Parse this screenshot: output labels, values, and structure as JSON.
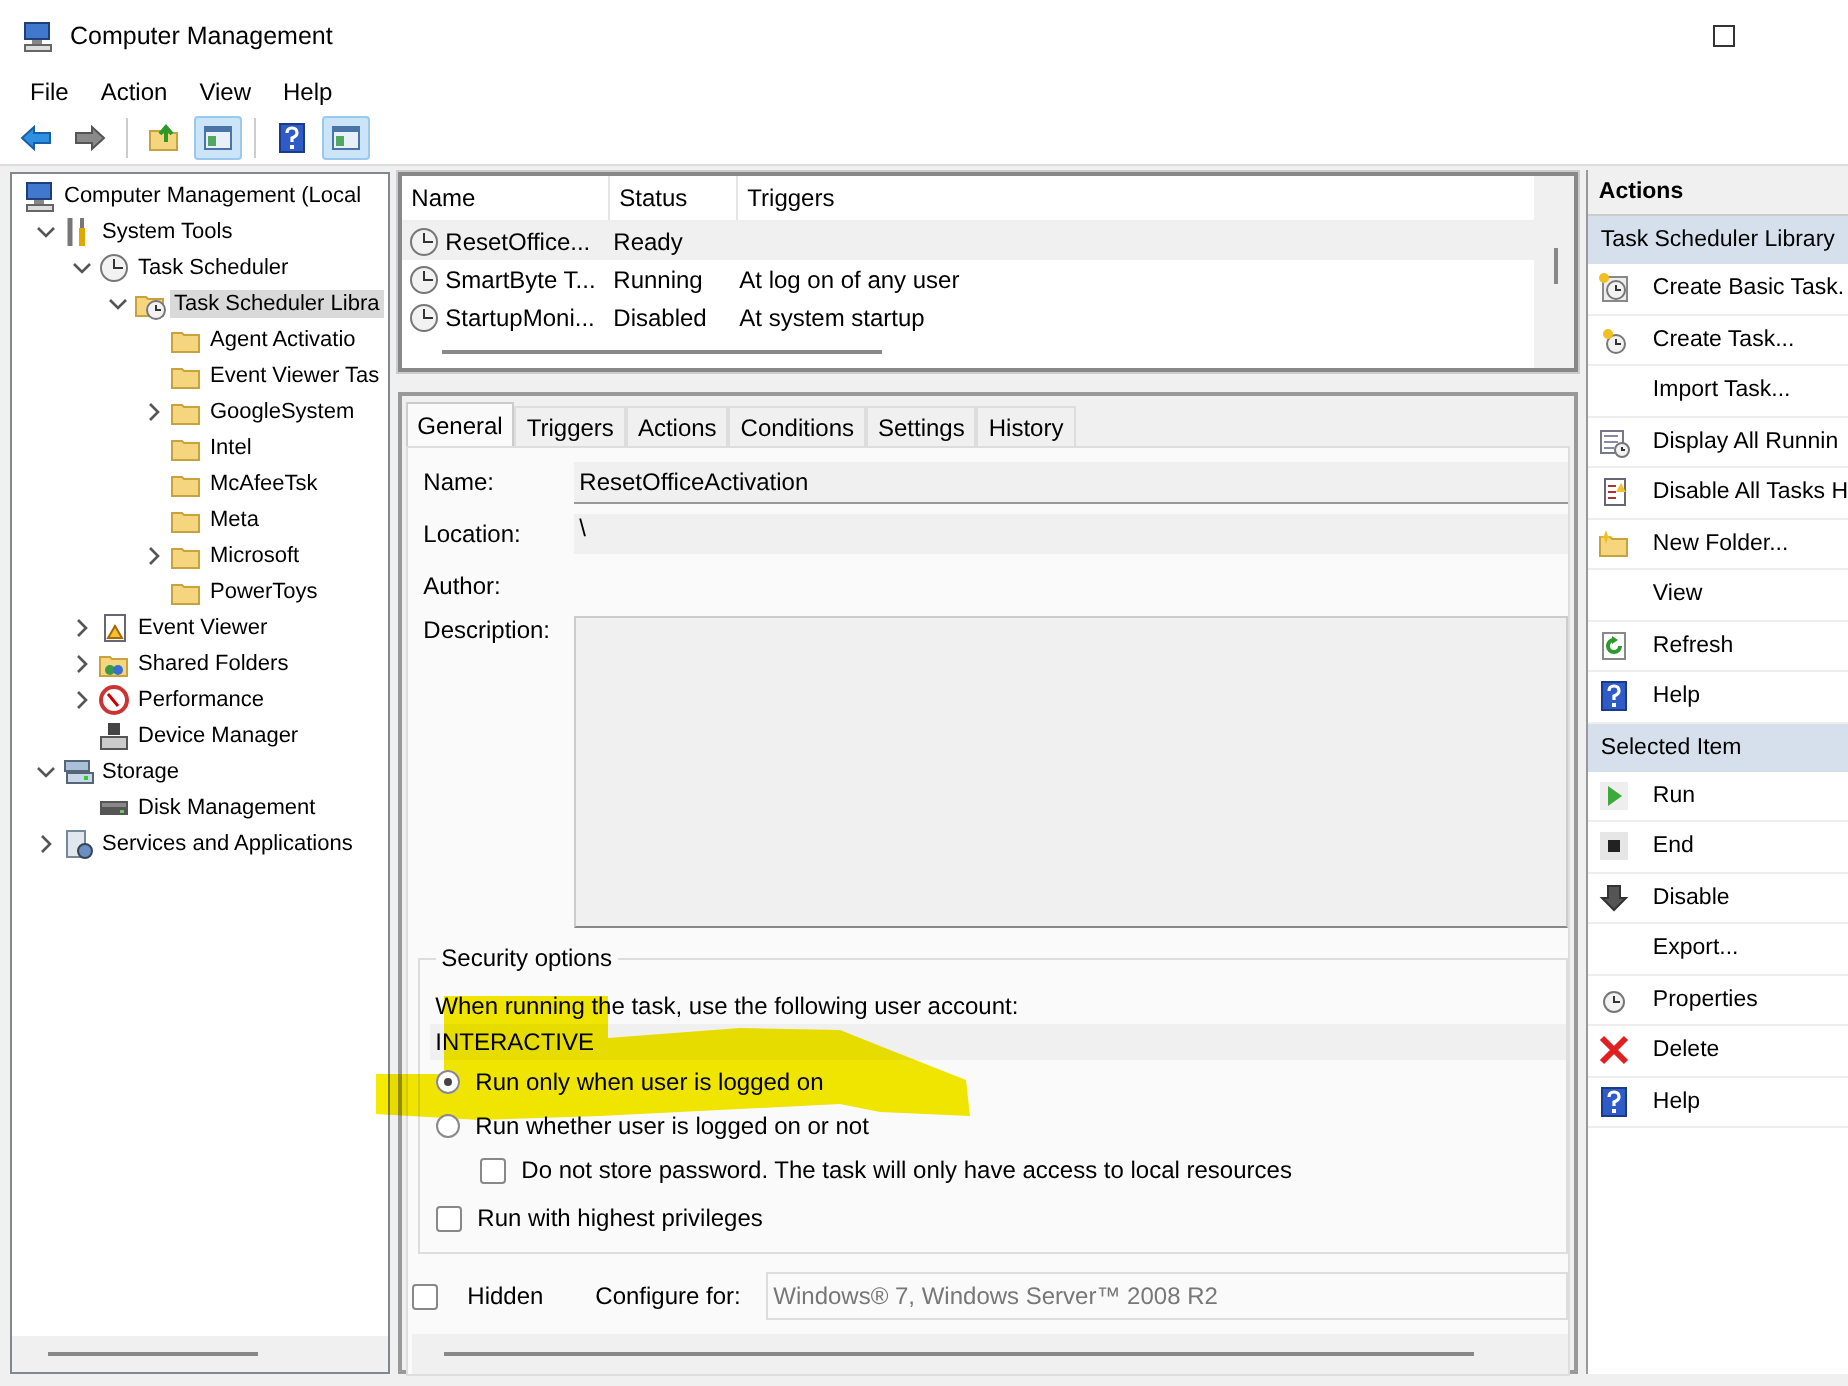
{
  "window": {
    "title": "Computer Management"
  },
  "menu": [
    "File",
    "Action",
    "View",
    "Help"
  ],
  "toolbar": [
    [
      {
        "kind": "back",
        "pressed": false
      },
      {
        "kind": "forward",
        "pressed": false
      }
    ],
    [
      {
        "kind": "up",
        "pressed": false
      },
      {
        "kind": "pane",
        "pressed": true
      }
    ],
    [
      {
        "kind": "help",
        "pressed": false
      },
      {
        "kind": "pane",
        "pressed": true
      }
    ]
  ],
  "tree": [
    {
      "label": "Computer Management (Local",
      "kind": "computer",
      "selected": false,
      "children": [
        {
          "label": "System Tools",
          "kind": "tools",
          "selected": false,
          "expanded": true,
          "children": [
            {
              "label": "Task Scheduler",
              "kind": "clock",
              "selected": false,
              "expanded": true,
              "children": [
                {
                  "label": "Task Scheduler Libra",
                  "kind": "clock-folder",
                  "selected": true,
                  "expanded": true,
                  "children": [
                    {
                      "label": "Agent Activatio",
                      "kind": "folder",
                      "selected": false
                    },
                    {
                      "label": "Event Viewer Tas",
                      "kind": "folder",
                      "selected": false
                    },
                    {
                      "label": "GoogleSystem",
                      "kind": "folder",
                      "selected": false,
                      "expanded": false
                    },
                    {
                      "label": "Intel",
                      "kind": "folder",
                      "selected": false
                    },
                    {
                      "label": "McAfeeTsk",
                      "kind": "folder",
                      "selected": false
                    },
                    {
                      "label": "Meta",
                      "kind": "folder",
                      "selected": false
                    },
                    {
                      "label": "Microsoft",
                      "kind": "folder",
                      "selected": false,
                      "expanded": false
                    },
                    {
                      "label": "PowerToys",
                      "kind": "folder",
                      "selected": false
                    }
                  ]
                }
              ]
            },
            {
              "label": "Event Viewer",
              "kind": "log",
              "selected": false,
              "expanded": false
            },
            {
              "label": "Shared Folders",
              "kind": "share",
              "selected": false,
              "expanded": false
            },
            {
              "label": "Performance",
              "kind": "gauge",
              "selected": false,
              "expanded": false
            },
            {
              "label": "Device Manager",
              "kind": "device",
              "selected": false
            }
          ]
        },
        {
          "label": "Storage",
          "kind": "storage",
          "selected": false,
          "expanded": true,
          "children": [
            {
              "label": "Disk Management",
              "kind": "disk",
              "selected": false
            }
          ]
        },
        {
          "label": "Services and Applications",
          "kind": "services",
          "selected": false,
          "expanded": false
        }
      ]
    }
  ],
  "tasks": {
    "columns": [
      "Name",
      "Status",
      "Triggers"
    ],
    "rows": [
      {
        "name": "ResetOffice...",
        "status": "Ready",
        "selected": true
      },
      {
        "name": "SmartByte T...",
        "status": "Running",
        "triggers": "At log on of any user",
        "selected": false
      },
      {
        "name": "StartupMoni...",
        "status": "Disabled",
        "triggers": "At system startup",
        "selected": false
      }
    ]
  },
  "tabs": [
    {
      "label": "General",
      "selected": true
    },
    {
      "label": "Triggers",
      "selected": false
    },
    {
      "label": "Actions",
      "selected": false
    },
    {
      "label": "Conditions",
      "selected": false
    },
    {
      "label": "Settings",
      "selected": false
    },
    {
      "label": "History",
      "selected": false
    }
  ],
  "general": {
    "name_label": "Name:",
    "name_value": "ResetOfficeActivation",
    "location_label": "Location:",
    "location_value": "\\",
    "author_label": "Author:",
    "description_label": "Description:"
  },
  "security": {
    "title": "Security options",
    "account_label": "When running the task, use the following user account:",
    "account_value": "INTERACTIVE",
    "options": [
      {
        "label": "Run only when user is logged on",
        "selected": true
      },
      {
        "label": "Run whether user is logged on or not",
        "selected": false,
        "sub_checkbox": {
          "label": "Do not store password.  The task will only have access to local resources",
          "checked": false
        }
      }
    ],
    "highest": {
      "label": "Run with highest privileges",
      "checked": false
    }
  },
  "footer": {
    "hidden": {
      "label": "Hidden",
      "checked": false
    },
    "configure_label": "Configure for:",
    "configure_value": "Windows® 7, Windows Server™ 2008 R2"
  },
  "actions": {
    "title": "Actions",
    "sections": [
      {
        "title": "Task Scheduler Library",
        "items": [
          {
            "label": "Create Basic Task.",
            "kind": "new-task"
          },
          {
            "label": "Create Task...",
            "kind": "new-task-small"
          },
          {
            "label": "Import Task...",
            "kind": "none"
          },
          {
            "label": "Display All Runnin",
            "kind": "list"
          },
          {
            "label": "Disable All Tasks H",
            "kind": "notes"
          },
          {
            "label": "New Folder...",
            "kind": "new-folder"
          },
          {
            "label": "View",
            "kind": "none"
          },
          {
            "label": "Refresh",
            "kind": "refresh"
          },
          {
            "label": "Help",
            "kind": "help"
          }
        ]
      },
      {
        "title": "Selected Item",
        "items": [
          {
            "label": "Run",
            "kind": "run"
          },
          {
            "label": "End",
            "kind": "end"
          },
          {
            "label": "Disable",
            "kind": "disable"
          },
          {
            "label": "Export...",
            "kind": "none"
          },
          {
            "label": "Properties",
            "kind": "properties"
          },
          {
            "label": "Delete",
            "kind": "delete"
          },
          {
            "label": "Help",
            "kind": "help"
          }
        ]
      }
    ]
  }
}
